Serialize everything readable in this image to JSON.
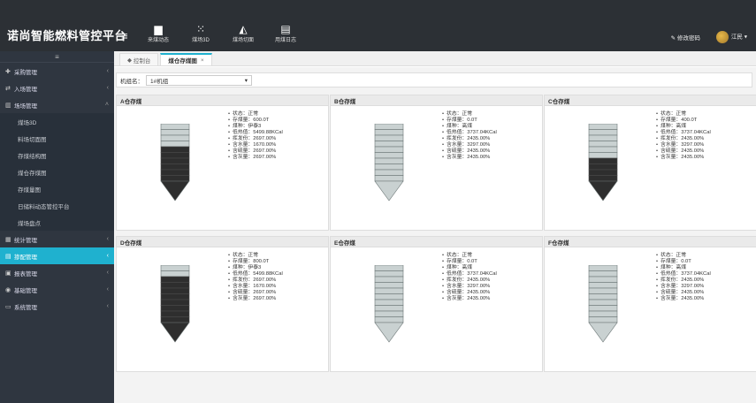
{
  "app": {
    "brand": "诺尚智能燃料管控平台",
    "menu_icon": "≡"
  },
  "topnav": [
    {
      "icon": "truck-icon",
      "glyph": "▆",
      "label": "来煤动态"
    },
    {
      "icon": "grid-icon",
      "glyph": "⁙",
      "label": "煤场3D"
    },
    {
      "icon": "chart-icon",
      "glyph": "◭",
      "label": "煤场切面"
    },
    {
      "icon": "log-icon",
      "glyph": "▤",
      "label": "用煤日志"
    }
  ],
  "topright": {
    "change_password": "修改密码",
    "user": "江民"
  },
  "sidebar": {
    "top_icon": "≡",
    "items": [
      {
        "icon": "✚",
        "label": "采购管理",
        "caret": "‹"
      },
      {
        "icon": "⇄",
        "label": "入场管理",
        "caret": "‹"
      },
      {
        "icon": "▥",
        "label": "场场管理",
        "caret": "˄"
      }
    ],
    "subitems": [
      "煤场3D",
      "料场切面图",
      "存煤结构图",
      "煤仓存煤图",
      "存煤量图",
      "日储料动态管控平台",
      "煤场盘点"
    ],
    "items2": [
      {
        "icon": "▦",
        "label": "统计管理",
        "caret": "‹",
        "active": false
      },
      {
        "icon": "▤",
        "label": "掺配管理",
        "caret": "‹",
        "active": true
      },
      {
        "icon": "▣",
        "label": "报表管理",
        "caret": "‹",
        "active": false
      },
      {
        "icon": "◉",
        "label": "基础管理",
        "caret": "‹",
        "active": false
      },
      {
        "icon": "▭",
        "label": "系统管理",
        "caret": "‹",
        "active": false
      }
    ]
  },
  "tabs": [
    {
      "label": "控制台",
      "icon": "◆",
      "active": false
    },
    {
      "label": "煤仓存煤图",
      "close": "×",
      "active": true
    }
  ],
  "filter": {
    "label": "机组名：",
    "selected": "1#机组",
    "arrow": "▾"
  },
  "silos": [
    {
      "title": "A仓存煤",
      "status": "状态：正常",
      "amount": "存煤量：600.0T",
      "coal": "煤种：伊泰3",
      "heat": "低热值：5499.88KCal",
      "volatile": "挥发份：2697.00%",
      "moisture": "含水量：1670.00%",
      "sulfur": "含硫量：2697.00%",
      "ash": "含灰量：2697.00%",
      "fill": 0.6
    },
    {
      "title": "B仓存煤",
      "status": "状态：正常",
      "amount": "存煤量：0.0T",
      "coal": "煤种：高煤",
      "heat": "低热值：3737.04KCal",
      "volatile": "挥发份：2435.00%",
      "moisture": "含水量：3297.00%",
      "sulfur": "含硫量：2435.00%",
      "ash": "含灰量：2435.00%",
      "fill": 0.0
    },
    {
      "title": "C仓存煤",
      "status": "状态：正常",
      "amount": "存煤量：400.0T",
      "coal": "煤种：高煤",
      "heat": "低热值：3737.04KCal",
      "volatile": "挥发份：2435.00%",
      "moisture": "含水量：3297.00%",
      "sulfur": "含硫量：2435.00%",
      "ash": "含灰量：2435.00%",
      "fill": 0.4
    },
    {
      "title": "D仓存煤",
      "status": "状态：正常",
      "amount": "存煤量：800.0T",
      "coal": "煤种：伊泰3",
      "heat": "低热值：5499.88KCal",
      "volatile": "挥发份：2697.00%",
      "moisture": "含水量：1670.00%",
      "sulfur": "含硫量：2697.00%",
      "ash": "含灰量：2697.00%",
      "fill": 0.8
    },
    {
      "title": "E仓存煤",
      "status": "状态：正常",
      "amount": "存煤量：0.0T",
      "coal": "煤种：高煤",
      "heat": "低热值：3737.04KCal",
      "volatile": "挥发份：2435.00%",
      "moisture": "含水量：3297.00%",
      "sulfur": "含硫量：2435.00%",
      "ash": "含灰量：2435.00%",
      "fill": 0.0
    },
    {
      "title": "F仓存煤",
      "status": "状态：正常",
      "amount": "存煤量：0.0T",
      "coal": "煤种：高煤",
      "heat": "低热值：3737.04KCal",
      "volatile": "挥发份：2435.00%",
      "moisture": "含水量：3297.00%",
      "sulfur": "含硫量：2435.00%",
      "ash": "含灰量：2435.00%",
      "fill": 0.0
    }
  ],
  "colors": {
    "coal": "#2e2e2e",
    "empty": "#c9d1d1",
    "accent": "#1fb1cf"
  }
}
